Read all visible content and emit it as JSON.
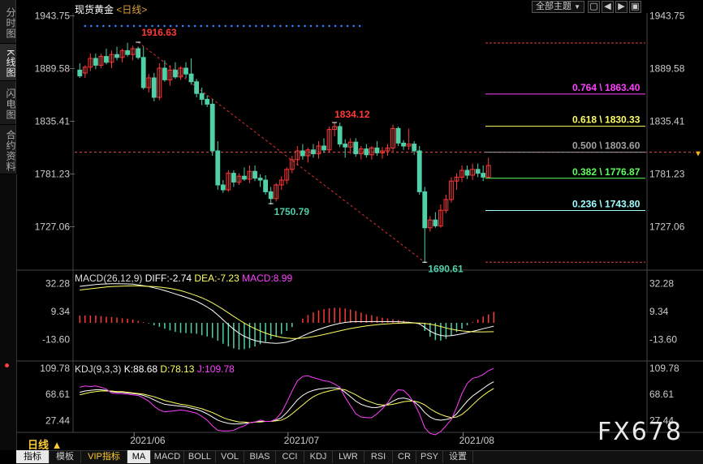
{
  "header": {
    "title": "现货黄金",
    "period_link": "<日线>",
    "theme_button": "全部主题",
    "theme_arrow": "▼"
  },
  "side_tabs": [
    "分时图",
    "K线图",
    "闪电图",
    "合约资料"
  ],
  "window_controls": [
    "▢",
    "◀",
    "▶",
    "▣"
  ],
  "price_axis": {
    "ticks": [
      "1943.75",
      "1889.58",
      "1835.41",
      "1781.23",
      "1727.06"
    ],
    "current_marker": "▼"
  },
  "macd": {
    "label": "MACD(26,12,9)",
    "diff": "DIFF:-2.74",
    "dea": "DEA:-7.23",
    "macd": "MACD:8.99",
    "ticks": [
      "32.28",
      "9.34",
      "-13.60"
    ]
  },
  "kdj": {
    "label": "KDJ(9,3,3)",
    "k": "K:88.68",
    "d": "D:78.13",
    "j": "J:109.78",
    "ticks": [
      "109.78",
      "68.61",
      "27.44"
    ]
  },
  "x_axis": {
    "months": [
      "2021/06",
      "2021/07",
      "2021/08"
    ],
    "period_selector": "日线 ▲"
  },
  "bottom_tabs": [
    "指标",
    "模板",
    "VIP指标",
    "MA",
    "MACD",
    "BOLL",
    "VOL",
    "BIAS",
    "CCI",
    "KDJ",
    "LWR",
    "RSI",
    "CR",
    "PSY",
    "设置"
  ],
  "watermark": "FX678",
  "colors": {
    "up": "#ff3838",
    "down": "#50d0a8",
    "fib_764": "#ff40ff",
    "fib_618": "#ffff60",
    "fib_500": "#a0a0a0",
    "fib_382": "#60ff60",
    "fib_236": "#a0ffff",
    "macd_dea": "#ffff60"
  },
  "chart_data": [
    {
      "type": "candlestick",
      "title": "现货黄金",
      "ylim": [
        1690,
        1950
      ],
      "annotations": [
        {
          "label": "1916.63",
          "value": 1916.63
        },
        {
          "label": "1750.79",
          "value": 1750.79
        },
        {
          "label": "1834.12",
          "value": 1834.12
        },
        {
          "label": "1690.61",
          "value": 1690.61
        }
      ],
      "fibonacci": [
        {
          "label": "0.764 \\ 1863.40",
          "value": 1863.4
        },
        {
          "label": "0.618 \\ 1830.33",
          "value": 1830.33
        },
        {
          "label": "0.500 \\ 1803.60",
          "value": 1803.6
        },
        {
          "label": "0.382 \\ 1776.87",
          "value": 1776.87
        },
        {
          "label": "0.236 \\ 1743.80",
          "value": 1743.8
        }
      ],
      "current_price": 1803.6,
      "candles": [
        [
          1888,
          1895,
          1880,
          1882
        ],
        [
          1885,
          1893,
          1880,
          1891
        ],
        [
          1891,
          1905,
          1887,
          1900
        ],
        [
          1900,
          1905,
          1889,
          1893
        ],
        [
          1893,
          1905,
          1890,
          1902
        ],
        [
          1902,
          1910,
          1894,
          1896
        ],
        [
          1896,
          1908,
          1890,
          1904
        ],
        [
          1904,
          1912,
          1898,
          1901
        ],
        [
          1901,
          1910,
          1896,
          1908
        ],
        [
          1908,
          1916,
          1902,
          1904
        ],
        [
          1904,
          1913,
          1898,
          1910
        ],
        [
          1910,
          1912,
          1899,
          1901
        ],
        [
          1901,
          1912,
          1868,
          1870
        ],
        [
          1870,
          1884,
          1865,
          1880
        ],
        [
          1880,
          1885,
          1856,
          1860
        ],
        [
          1860,
          1895,
          1857,
          1890
        ],
        [
          1890,
          1898,
          1876,
          1878
        ],
        [
          1878,
          1893,
          1872,
          1888
        ],
        [
          1888,
          1896,
          1879,
          1881
        ],
        [
          1881,
          1892,
          1878,
          1890
        ],
        [
          1890,
          1896,
          1880,
          1884
        ],
        [
          1884,
          1900,
          1873,
          1876
        ],
        [
          1876,
          1879,
          1860,
          1864
        ],
        [
          1864,
          1870,
          1852,
          1858
        ],
        [
          1858,
          1862,
          1850,
          1853
        ],
        [
          1853,
          1858,
          1800,
          1805
        ],
        [
          1805,
          1815,
          1765,
          1770
        ],
        [
          1770,
          1775,
          1762,
          1765
        ],
        [
          1765,
          1785,
          1763,
          1782
        ],
        [
          1782,
          1785,
          1768,
          1773
        ],
        [
          1773,
          1782,
          1770,
          1779
        ],
        [
          1779,
          1788,
          1774,
          1776
        ],
        [
          1776,
          1790,
          1772,
          1784
        ],
        [
          1784,
          1790,
          1774,
          1777
        ],
        [
          1777,
          1781,
          1768,
          1775
        ],
        [
          1775,
          1780,
          1760,
          1763
        ],
        [
          1763,
          1768,
          1750,
          1756
        ],
        [
          1756,
          1772,
          1753,
          1770
        ],
        [
          1770,
          1779,
          1765,
          1775
        ],
        [
          1775,
          1788,
          1771,
          1786
        ],
        [
          1786,
          1800,
          1782,
          1796
        ],
        [
          1796,
          1810,
          1790,
          1805
        ],
        [
          1805,
          1812,
          1796,
          1800
        ],
        [
          1800,
          1808,
          1793,
          1806
        ],
        [
          1806,
          1812,
          1798,
          1802
        ],
        [
          1802,
          1815,
          1797,
          1810
        ],
        [
          1810,
          1818,
          1803,
          1806
        ],
        [
          1806,
          1830,
          1803,
          1827
        ],
        [
          1827,
          1834,
          1820,
          1830
        ],
        [
          1830,
          1834,
          1809,
          1812
        ],
        [
          1812,
          1817,
          1798,
          1809
        ],
        [
          1809,
          1818,
          1802,
          1814
        ],
        [
          1814,
          1818,
          1799,
          1802
        ],
        [
          1802,
          1810,
          1796,
          1807
        ],
        [
          1807,
          1812,
          1798,
          1801
        ],
        [
          1801,
          1810,
          1796,
          1808
        ],
        [
          1808,
          1815,
          1800,
          1803
        ],
        [
          1803,
          1809,
          1797,
          1805
        ],
        [
          1805,
          1812,
          1800,
          1808
        ],
        [
          1808,
          1832,
          1804,
          1828
        ],
        [
          1828,
          1830,
          1810,
          1813
        ],
        [
          1813,
          1816,
          1806,
          1810
        ],
        [
          1810,
          1828,
          1806,
          1812
        ],
        [
          1812,
          1815,
          1801,
          1805
        ],
        [
          1805,
          1810,
          1760,
          1763
        ],
        [
          1763,
          1768,
          1690,
          1726
        ],
        [
          1726,
          1738,
          1722,
          1734
        ],
        [
          1734,
          1742,
          1726,
          1728
        ],
        [
          1728,
          1750,
          1726,
          1744
        ],
        [
          1744,
          1760,
          1741,
          1755
        ],
        [
          1755,
          1778,
          1752,
          1774
        ],
        [
          1774,
          1782,
          1765,
          1778
        ],
        [
          1778,
          1790,
          1773,
          1785
        ],
        [
          1785,
          1790,
          1776,
          1780
        ],
        [
          1780,
          1792,
          1775,
          1786
        ],
        [
          1786,
          1792,
          1778,
          1782
        ],
        [
          1782,
          1790,
          1774,
          1778
        ],
        [
          1778,
          1798,
          1777,
          1790
        ]
      ]
    },
    {
      "type": "bar",
      "title": "MACD(26,12,9)",
      "ylim": [
        -30,
        40
      ],
      "series": [
        {
          "name": "DIFF",
          "values": [
            30,
            30.5,
            31,
            31.5,
            31.8,
            32,
            32.2,
            32.2,
            32.1,
            32,
            31.8,
            31.2,
            30.5,
            29.8,
            28.8,
            27.8,
            26.5,
            25.2,
            23.8,
            22.4,
            21,
            19.5,
            17.8,
            15.5,
            13,
            10.2,
            6.5,
            2.5,
            -1.5,
            -5.2,
            -8.5,
            -11,
            -13,
            -14.5,
            -15.5,
            -16.2,
            -16.6,
            -16.8,
            -16.5,
            -15.8,
            -14.5,
            -12.8,
            -10.8,
            -8.8,
            -7,
            -5.4,
            -4,
            -2.6,
            -1.4,
            -0.4,
            0.3,
            0.8,
            1,
            1,
            1,
            1.1,
            1.1,
            1,
            1,
            1,
            0.9,
            0.7,
            0.4,
            0,
            -0.8,
            -3.8,
            -6.8,
            -9,
            -10.3,
            -10.8,
            -10.5,
            -9.8,
            -9,
            -8,
            -7,
            -6,
            -4.8,
            -3.8,
            -2.74
          ]
        },
        {
          "name": "DEA",
          "values": [
            27,
            27.5,
            28,
            28.5,
            29,
            29.5,
            29.8,
            30,
            30.2,
            30.3,
            30.4,
            30.4,
            30.2,
            30,
            29.8,
            29.4,
            28.9,
            28.3,
            27.5,
            26.5,
            25.2,
            23.8,
            22.3,
            20.6,
            18.6,
            16.4,
            13.8,
            11.1,
            8.2,
            5.3,
            2.5,
            -0.2,
            -2.6,
            -4.8,
            -6.7,
            -8.4,
            -9.9,
            -11,
            -11.9,
            -12.5,
            -12.8,
            -12.8,
            -12.5,
            -12,
            -11.3,
            -10.5,
            -9.6,
            -8.6,
            -7.6,
            -6.6,
            -5.6,
            -4.7,
            -3.9,
            -3.2,
            -2.5,
            -2,
            -1.5,
            -1.1,
            -0.8,
            -0.5,
            -0.3,
            -0.2,
            -0.1,
            -0.1,
            -0.2,
            -0.5,
            -1.1,
            -1.9,
            -3,
            -4.2,
            -5.2,
            -6,
            -6.6,
            -7,
            -7.3,
            -7.4,
            -7.4,
            -7.3,
            -7.23
          ]
        },
        {
          "name": "MACD",
          "values": [
            6,
            6,
            6,
            6,
            5.6,
            5,
            4.8,
            4.4,
            3.8,
            3.4,
            2.8,
            1.6,
            0.6,
            -0.4,
            -2,
            -3.2,
            -4.8,
            -6.2,
            -7.4,
            -8.2,
            -8.4,
            -8.6,
            -9,
            -10.2,
            -11.2,
            -12.4,
            -14.6,
            -17.2,
            -19.4,
            -21,
            -22,
            -21.6,
            -20.8,
            -19.4,
            -17.6,
            -15.6,
            -13.4,
            -11.6,
            -9.2,
            -6.6,
            -3.4,
            0,
            3.4,
            6.4,
            8.6,
            10.2,
            11.2,
            12,
            12.4,
            12.4,
            11.8,
            11,
            9.8,
            8.4,
            7,
            6.2,
            5.2,
            4.2,
            3.6,
            3,
            2.4,
            1.8,
            1,
            0.2,
            -1.2,
            -6.6,
            -11.4,
            -14.2,
            -14.6,
            -13.2,
            -10.6,
            -7.6,
            -4.8,
            -2,
            0.6,
            2.8,
            5.2,
            7,
            8.99
          ]
        }
      ]
    },
    {
      "type": "line",
      "title": "KDJ(9,3,3)",
      "ylim": [
        10,
        115
      ],
      "series": [
        {
          "name": "K",
          "values": [
            72,
            74,
            75,
            76,
            76,
            75,
            73,
            72,
            72,
            71,
            70,
            69,
            67,
            64,
            60,
            56,
            53,
            52,
            51,
            50,
            49,
            47,
            45,
            42,
            38,
            33,
            28,
            25,
            23,
            22,
            22,
            23,
            24,
            25,
            26,
            26,
            26,
            28,
            32,
            40,
            50,
            60,
            67,
            72,
            75,
            77,
            78,
            79,
            79,
            78,
            72,
            65,
            58,
            53,
            50,
            48,
            48,
            50,
            53,
            58,
            62,
            63,
            61,
            57,
            50,
            40,
            33,
            29,
            28,
            29,
            31,
            38,
            48,
            58,
            66,
            72,
            78,
            84,
            88.68
          ]
        },
        {
          "name": "D",
          "values": [
            68,
            70,
            72,
            73,
            74,
            74,
            74,
            73,
            73,
            72,
            71,
            70,
            69,
            67,
            65,
            62,
            59,
            57,
            55,
            53,
            52,
            50,
            48,
            46,
            43,
            40,
            36,
            32,
            29,
            27,
            25,
            25,
            24,
            25,
            25,
            26,
            26,
            27,
            28,
            32,
            38,
            45,
            52,
            59,
            65,
            69,
            72,
            74,
            76,
            77,
            76,
            72,
            68,
            63,
            59,
            56,
            53,
            52,
            52,
            53,
            55,
            57,
            58,
            58,
            56,
            52,
            46,
            41,
            37,
            34,
            32,
            33,
            37,
            44,
            52,
            60,
            67,
            73,
            78.13
          ]
        },
        {
          "name": "J",
          "values": [
            80,
            82,
            81,
            82,
            80,
            77,
            71,
            70,
            70,
            69,
            68,
            67,
            63,
            58,
            50,
            44,
            41,
            42,
            43,
            44,
            43,
            41,
            39,
            34,
            28,
            19,
            12,
            11,
            11,
            12,
            16,
            19,
            24,
            25,
            28,
            26,
            26,
            30,
            40,
            56,
            74,
            90,
            97,
            98,
            95,
            93,
            90,
            89,
            85,
            80,
            64,
            51,
            38,
            33,
            32,
            32,
            38,
            46,
            55,
            68,
            76,
            75,
            67,
            55,
            38,
            16,
            7,
            5,
            10,
            19,
            29,
            48,
            70,
            86,
            94,
            96,
            100,
            106,
            109.78
          ]
        }
      ]
    }
  ]
}
